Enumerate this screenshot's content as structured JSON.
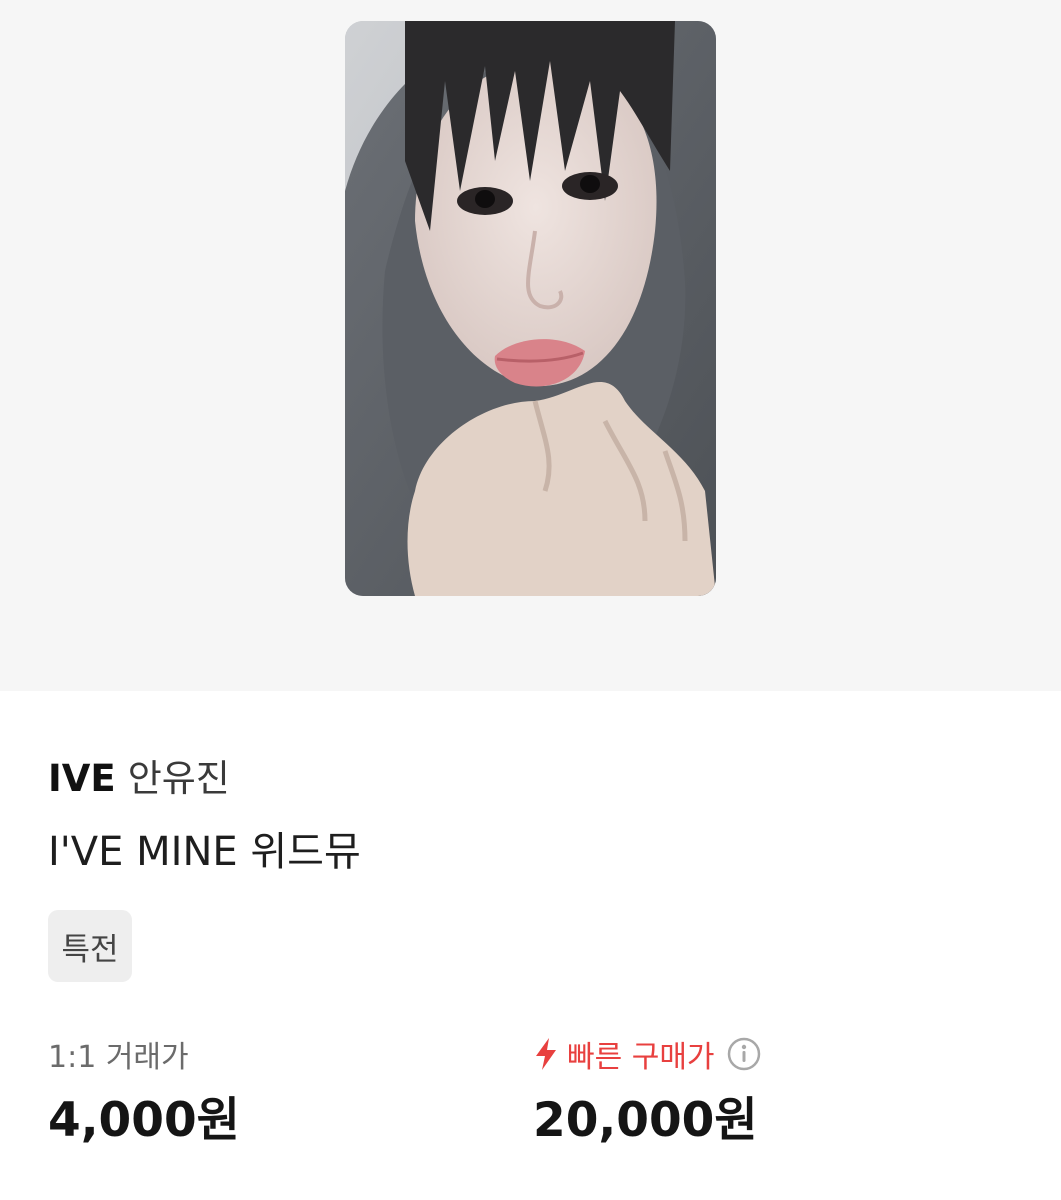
{
  "photo": {
    "icon": "photocard-image"
  },
  "product": {
    "group": "IVE",
    "member": "안유진",
    "title": "I'VE MINE 위드뮤",
    "tag": "특전"
  },
  "prices": {
    "trade_label": "1:1 거래가",
    "trade_value": "4,000원",
    "fast_label": "빠른 구매가",
    "fast_value": "20,000원"
  },
  "colors": {
    "accent": "#e8403f",
    "image_bg": "#f6f6f6",
    "tag_bg": "#eeeeee"
  }
}
